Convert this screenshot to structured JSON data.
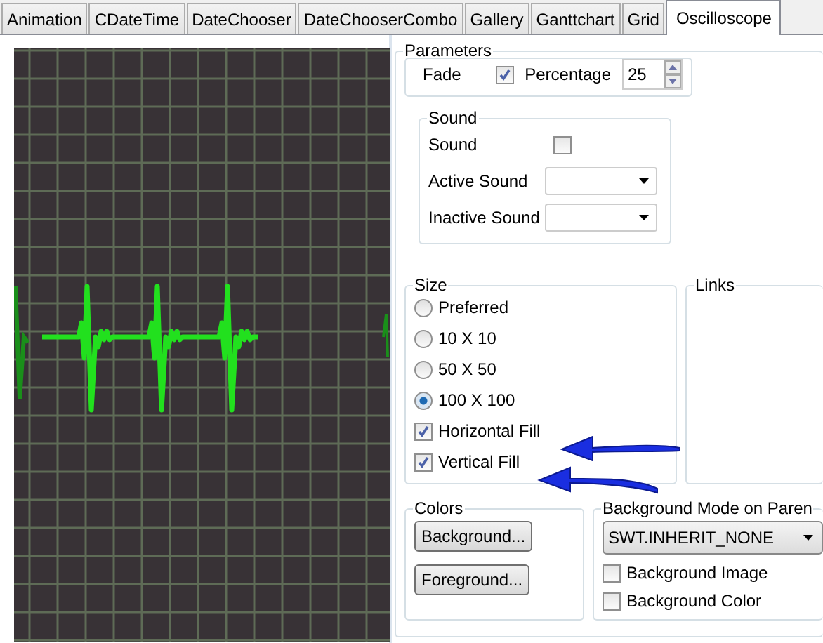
{
  "tabs": [
    {
      "label": "Animation",
      "selected": false
    },
    {
      "label": "CDateTime",
      "selected": false
    },
    {
      "label": "DateChooser",
      "selected": false
    },
    {
      "label": "DateChooserCombo",
      "selected": false
    },
    {
      "label": "Gallery",
      "selected": false
    },
    {
      "label": "Ganttchart",
      "selected": false
    },
    {
      "label": "Grid",
      "selected": false
    },
    {
      "label": "Oscilloscope",
      "selected": true
    }
  ],
  "parameters": {
    "title": "Parameters",
    "fade_label": "Fade",
    "percentage": {
      "label": "Percentage",
      "checked": true
    },
    "percentage_value": "25"
  },
  "sound": {
    "title": "Sound",
    "sound_label": "Sound",
    "sound_checked": false,
    "active_label": "Active Sound",
    "inactive_label": "Inactive Sound"
  },
  "size": {
    "title": "Size",
    "options": [
      {
        "label": "Preferred",
        "selected": false
      },
      {
        "label": "10 X 10",
        "selected": false
      },
      {
        "label": "50 X 50",
        "selected": false
      },
      {
        "label": "100 X 100",
        "selected": true
      }
    ],
    "fills": [
      {
        "label": "Horizontal Fill",
        "checked": true
      },
      {
        "label": "Vertical Fill",
        "checked": true
      }
    ]
  },
  "links": {
    "title": "Links"
  },
  "colors": {
    "title": "Colors",
    "buttons": [
      "Background...",
      "Foreground..."
    ]
  },
  "background_mode": {
    "title": "Background Mode on Paren",
    "value": "SWT.INHERIT_NONE",
    "checks": [
      {
        "label": "Background Image",
        "checked": false
      },
      {
        "label": "Background Color",
        "checked": false
      }
    ]
  }
}
